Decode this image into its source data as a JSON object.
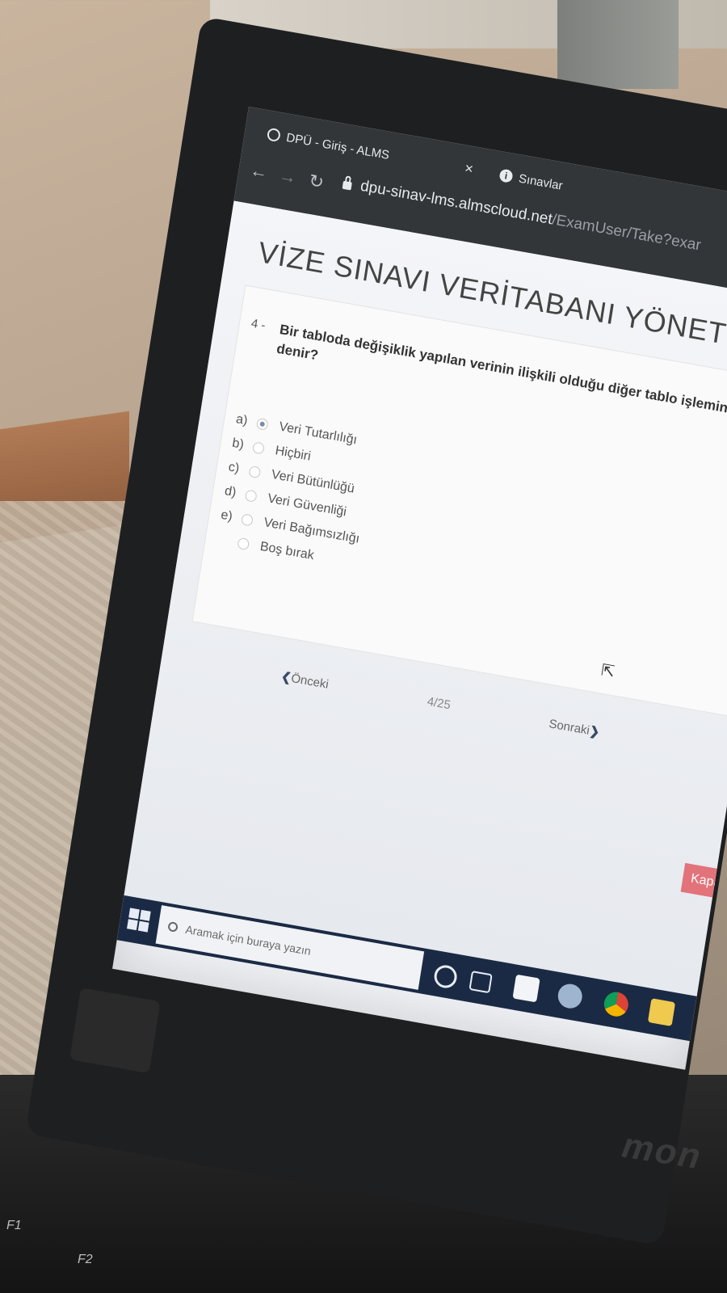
{
  "browser": {
    "tab_active": "DPÜ - Giriş - ALMS",
    "tab_close": "×",
    "tab_second": "Sınavlar",
    "info_glyph": "i",
    "url_domain": "dpu-sinav-lms.almscloud.net",
    "url_path": "/ExamUser/Take?exar"
  },
  "exam": {
    "title": "VİZE SINAVI VERİTABANI YÖNETİM SİSTE",
    "question_number": "4 -",
    "question_text": "Bir tabloda değişiklik yapılan verinin ilişkili olduğu diğer tablo işlemine ne denir?",
    "options": [
      {
        "letter": "a)",
        "label": "Veri Tutarlılığı",
        "selected": true
      },
      {
        "letter": "b)",
        "label": "Hiçbiri",
        "selected": false
      },
      {
        "letter": "c)",
        "label": "Veri Bütünlüğü",
        "selected": false
      },
      {
        "letter": "d)",
        "label": "Veri Güvenliği",
        "selected": false
      },
      {
        "letter": "e)",
        "label": "Veri Bağımsızlığı",
        "selected": false
      }
    ],
    "blank_option": "Boş bırak",
    "prev_arrow": "❮",
    "prev_label": "Önceki",
    "progress": "4/25",
    "next_label": "Sonraki",
    "next_arrow": "❯",
    "close_label": "Kapa"
  },
  "taskbar": {
    "search_placeholder": "Aramak için buraya yazın"
  },
  "keyboard": {
    "f1": "F1",
    "f2": "F2",
    "brand": "mon"
  },
  "colors": {
    "browser_chrome": "#323639",
    "close_button": "#e2737a",
    "taskbar": "#1b2a44"
  }
}
